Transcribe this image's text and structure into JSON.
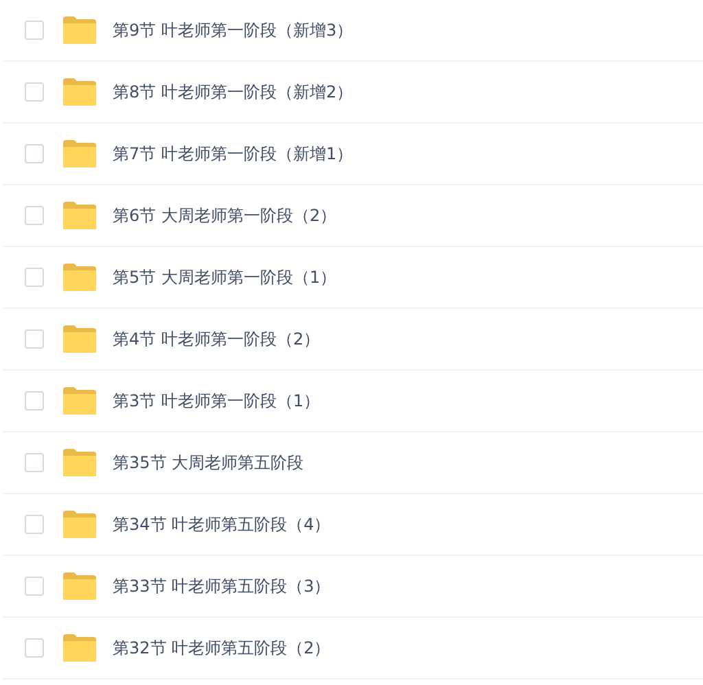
{
  "files": [
    {
      "name": "第9节 叶老师第一阶段（新增3）",
      "checked": false
    },
    {
      "name": "第8节 叶老师第一阶段（新增2）",
      "checked": false
    },
    {
      "name": "第7节 叶老师第一阶段（新增1）",
      "checked": false
    },
    {
      "name": "第6节 大周老师第一阶段（2）",
      "checked": false
    },
    {
      "name": "第5节 大周老师第一阶段（1）",
      "checked": false
    },
    {
      "name": "第4节 叶老师第一阶段（2）",
      "checked": false
    },
    {
      "name": "第3节 叶老师第一阶段（1）",
      "checked": false
    },
    {
      "name": "第35节 大周老师第五阶段",
      "checked": false
    },
    {
      "name": "第34节 叶老师第五阶段（4）",
      "checked": false
    },
    {
      "name": "第33节 叶老师第五阶段（3）",
      "checked": false
    },
    {
      "name": "第32节 叶老师第五阶段（2）",
      "checked": false
    }
  ]
}
